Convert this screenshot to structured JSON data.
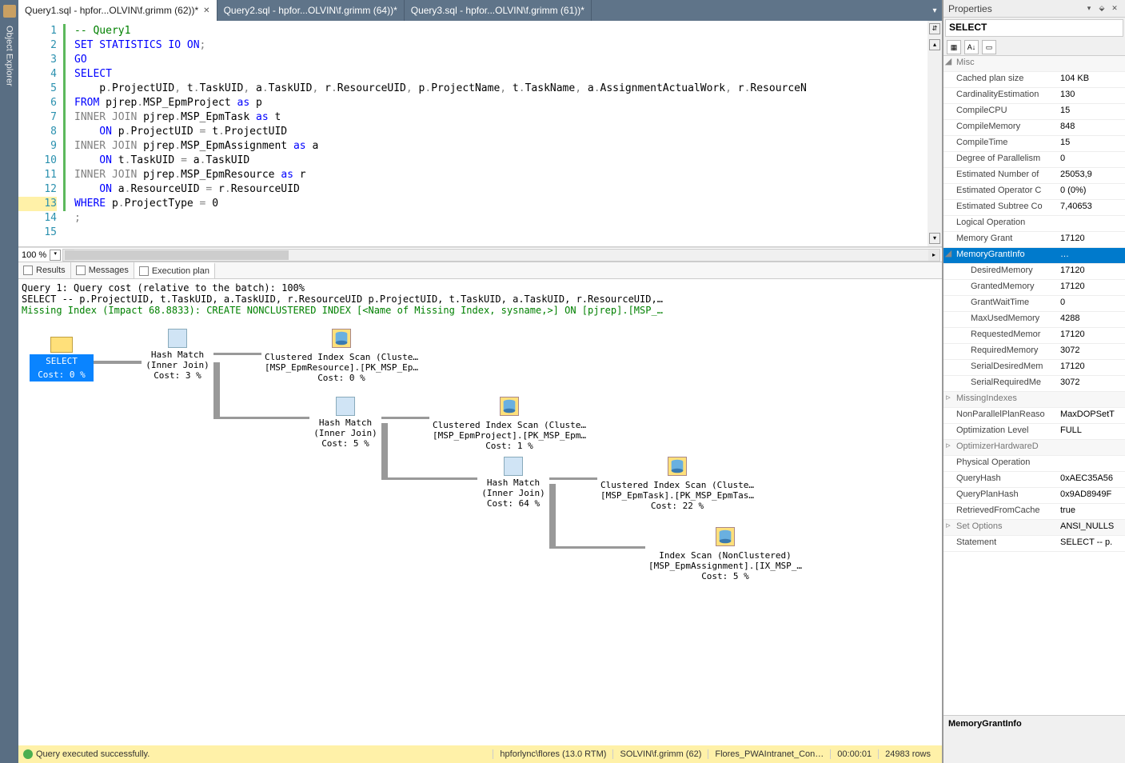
{
  "sidebar": {
    "label": "Object Explorer"
  },
  "tabs": [
    {
      "label": "Query1.sql - hpfor...OLVIN\\f.grimm (62))*",
      "active": true
    },
    {
      "label": "Query2.sql - hpfor...OLVIN\\f.grimm (64))*",
      "active": false
    },
    {
      "label": "Query3.sql - hpfor...OLVIN\\f.grimm (61))*",
      "active": false
    }
  ],
  "code": {
    "lines": [
      {
        "n": 1,
        "segments": [
          {
            "t": "-- Query1",
            "c": "c-comment"
          }
        ]
      },
      {
        "n": 2,
        "segments": [
          {
            "t": "SET",
            "c": "c-kw"
          },
          {
            "t": " STATISTICS IO ON",
            "c": "c-kw"
          },
          {
            "t": ";",
            "c": "c-gray"
          }
        ]
      },
      {
        "n": 3,
        "segments": [
          {
            "t": "GO",
            "c": "c-kw"
          }
        ]
      },
      {
        "n": 4,
        "segments": [
          {
            "t": "SELECT",
            "c": "c-kw"
          }
        ]
      },
      {
        "n": 5,
        "segments": [
          {
            "t": "    p",
            "c": "c-text"
          },
          {
            "t": ".",
            "c": "c-gray"
          },
          {
            "t": "ProjectUID",
            "c": "c-text"
          },
          {
            "t": ",",
            "c": "c-gray"
          },
          {
            "t": " t",
            "c": "c-text"
          },
          {
            "t": ".",
            "c": "c-gray"
          },
          {
            "t": "TaskUID",
            "c": "c-text"
          },
          {
            "t": ",",
            "c": "c-gray"
          },
          {
            "t": " a",
            "c": "c-text"
          },
          {
            "t": ".",
            "c": "c-gray"
          },
          {
            "t": "TaskUID",
            "c": "c-text"
          },
          {
            "t": ",",
            "c": "c-gray"
          },
          {
            "t": " r",
            "c": "c-text"
          },
          {
            "t": ".",
            "c": "c-gray"
          },
          {
            "t": "ResourceUID",
            "c": "c-text"
          },
          {
            "t": ",",
            "c": "c-gray"
          },
          {
            "t": " p",
            "c": "c-text"
          },
          {
            "t": ".",
            "c": "c-gray"
          },
          {
            "t": "ProjectName",
            "c": "c-text"
          },
          {
            "t": ",",
            "c": "c-gray"
          },
          {
            "t": " t",
            "c": "c-text"
          },
          {
            "t": ".",
            "c": "c-gray"
          },
          {
            "t": "TaskName",
            "c": "c-text"
          },
          {
            "t": ",",
            "c": "c-gray"
          },
          {
            "t": " a",
            "c": "c-text"
          },
          {
            "t": ".",
            "c": "c-gray"
          },
          {
            "t": "AssignmentActualWork",
            "c": "c-text"
          },
          {
            "t": ",",
            "c": "c-gray"
          },
          {
            "t": " r",
            "c": "c-text"
          },
          {
            "t": ".",
            "c": "c-gray"
          },
          {
            "t": "ResourceN",
            "c": "c-text"
          }
        ]
      },
      {
        "n": 6,
        "segments": [
          {
            "t": "FROM",
            "c": "c-kw"
          },
          {
            "t": " pjrep",
            "c": "c-text"
          },
          {
            "t": ".",
            "c": "c-gray"
          },
          {
            "t": "MSP_EpmProject ",
            "c": "c-text"
          },
          {
            "t": "as",
            "c": "c-kw"
          },
          {
            "t": " p",
            "c": "c-text"
          }
        ]
      },
      {
        "n": 7,
        "segments": [
          {
            "t": "INNER",
            "c": "c-gray"
          },
          {
            "t": " ",
            "c": "c-text"
          },
          {
            "t": "JOIN",
            "c": "c-gray"
          },
          {
            "t": " pjrep",
            "c": "c-text"
          },
          {
            "t": ".",
            "c": "c-gray"
          },
          {
            "t": "MSP_EpmTask ",
            "c": "c-text"
          },
          {
            "t": "as",
            "c": "c-kw"
          },
          {
            "t": " t",
            "c": "c-text"
          }
        ]
      },
      {
        "n": 8,
        "segments": [
          {
            "t": "    ON",
            "c": "c-kw"
          },
          {
            "t": " p",
            "c": "c-text"
          },
          {
            "t": ".",
            "c": "c-gray"
          },
          {
            "t": "ProjectUID ",
            "c": "c-text"
          },
          {
            "t": "=",
            "c": "c-gray"
          },
          {
            "t": " t",
            "c": "c-text"
          },
          {
            "t": ".",
            "c": "c-gray"
          },
          {
            "t": "ProjectUID",
            "c": "c-text"
          }
        ]
      },
      {
        "n": 9,
        "segments": [
          {
            "t": "INNER",
            "c": "c-gray"
          },
          {
            "t": " ",
            "c": "c-text"
          },
          {
            "t": "JOIN",
            "c": "c-gray"
          },
          {
            "t": " pjrep",
            "c": "c-text"
          },
          {
            "t": ".",
            "c": "c-gray"
          },
          {
            "t": "MSP_EpmAssignment ",
            "c": "c-text"
          },
          {
            "t": "as",
            "c": "c-kw"
          },
          {
            "t": " a",
            "c": "c-text"
          }
        ]
      },
      {
        "n": 10,
        "segments": [
          {
            "t": "    ON",
            "c": "c-kw"
          },
          {
            "t": " t",
            "c": "c-text"
          },
          {
            "t": ".",
            "c": "c-gray"
          },
          {
            "t": "TaskUID ",
            "c": "c-text"
          },
          {
            "t": "=",
            "c": "c-gray"
          },
          {
            "t": " a",
            "c": "c-text"
          },
          {
            "t": ".",
            "c": "c-gray"
          },
          {
            "t": "TaskUID",
            "c": "c-text"
          }
        ]
      },
      {
        "n": 11,
        "segments": [
          {
            "t": "INNER",
            "c": "c-gray"
          },
          {
            "t": " ",
            "c": "c-text"
          },
          {
            "t": "JOIN",
            "c": "c-gray"
          },
          {
            "t": " pjrep",
            "c": "c-text"
          },
          {
            "t": ".",
            "c": "c-gray"
          },
          {
            "t": "MSP_EpmResource ",
            "c": "c-text"
          },
          {
            "t": "as",
            "c": "c-kw"
          },
          {
            "t": " r",
            "c": "c-text"
          }
        ]
      },
      {
        "n": 12,
        "segments": [
          {
            "t": "    ON",
            "c": "c-kw"
          },
          {
            "t": " a",
            "c": "c-text"
          },
          {
            "t": ".",
            "c": "c-gray"
          },
          {
            "t": "ResourceUID ",
            "c": "c-text"
          },
          {
            "t": "=",
            "c": "c-gray"
          },
          {
            "t": " r",
            "c": "c-text"
          },
          {
            "t": ".",
            "c": "c-gray"
          },
          {
            "t": "ResourceUID",
            "c": "c-text"
          }
        ]
      },
      {
        "n": 13,
        "hl": true,
        "segments": [
          {
            "t": "WHERE",
            "c": "c-kw"
          },
          {
            "t": " p",
            "c": "c-text"
          },
          {
            "t": ".",
            "c": "c-gray"
          },
          {
            "t": "ProjectType ",
            "c": "c-text"
          },
          {
            "t": "=",
            "c": "c-gray"
          },
          {
            "t": " 0",
            "c": "c-text"
          }
        ]
      },
      {
        "n": 14,
        "segments": [
          {
            "t": ";",
            "c": "c-gray"
          }
        ]
      },
      {
        "n": 15,
        "segments": [
          {
            "t": "",
            "c": "c-text"
          }
        ]
      }
    ]
  },
  "zoom": "100 %",
  "result_tabs": [
    {
      "label": "Results",
      "active": false
    },
    {
      "label": "Messages",
      "active": false
    },
    {
      "label": "Execution plan",
      "active": true
    }
  ],
  "plan": {
    "header1": "Query 1: Query cost (relative to the batch): 100%",
    "header2": "SELECT -- p.ProjectUID, t.TaskUID, a.TaskUID, r.ResourceUID p.ProjectUID, t.TaskUID, a.TaskUID, r.ResourceUID,…",
    "header3": "Missing Index (Impact 68.8833): CREATE NONCLUSTERED INDEX [<Name of Missing Index, sysname,>] ON [pjrep].[MSP_…",
    "select": {
      "label": "SELECT",
      "cost": "Cost: 0 %"
    },
    "nodes": [
      {
        "id": "hm1",
        "title": "Hash Match",
        "sub": "(Inner Join)",
        "cost": "Cost: 3 %"
      },
      {
        "id": "cis1",
        "title": "Clustered Index Scan (Cluste…",
        "sub": "[MSP_EpmResource].[PK_MSP_Ep…",
        "cost": "Cost: 0 %"
      },
      {
        "id": "hm2",
        "title": "Hash Match",
        "sub": "(Inner Join)",
        "cost": "Cost: 5 %"
      },
      {
        "id": "cis2",
        "title": "Clustered Index Scan (Cluste…",
        "sub": "[MSP_EpmProject].[PK_MSP_Epm…",
        "cost": "Cost: 1 %"
      },
      {
        "id": "hm3",
        "title": "Hash Match",
        "sub": "(Inner Join)",
        "cost": "Cost: 64 %"
      },
      {
        "id": "cis3",
        "title": "Clustered Index Scan (Cluste…",
        "sub": "[MSP_EpmTask].[PK_MSP_EpmTas…",
        "cost": "Cost: 22 %"
      },
      {
        "id": "is1",
        "title": "Index Scan (NonClustered)",
        "sub": "[MSP_EpmAssignment].[IX_MSP_…",
        "cost": "Cost: 5 %"
      }
    ]
  },
  "status": {
    "msg": "Query executed successfully.",
    "server": "hpforlync\\flores (13.0 RTM)",
    "user": "SOLVIN\\f.grimm (62)",
    "db": "Flores_PWAIntranet_Con…",
    "time": "00:00:01",
    "rows": "24983 rows"
  },
  "properties": {
    "title": "Properties",
    "object": "SELECT",
    "rows": [
      {
        "type": "cat",
        "exp": "◢",
        "name": "Misc",
        "val": ""
      },
      {
        "type": "p",
        "name": "Cached plan size",
        "val": "104 KB"
      },
      {
        "type": "p",
        "name": "CardinalityEstimation",
        "val": "130"
      },
      {
        "type": "p",
        "name": "CompileCPU",
        "val": "15"
      },
      {
        "type": "p",
        "name": "CompileMemory",
        "val": "848"
      },
      {
        "type": "p",
        "name": "CompileTime",
        "val": "15"
      },
      {
        "type": "p",
        "name": "Degree of Parallelism",
        "val": "0"
      },
      {
        "type": "p",
        "name": "Estimated Number of",
        "val": "25053,9"
      },
      {
        "type": "p",
        "name": "Estimated Operator C",
        "val": "0 (0%)"
      },
      {
        "type": "p",
        "name": "Estimated Subtree Co",
        "val": "7,40653"
      },
      {
        "type": "p",
        "name": "Logical Operation",
        "val": ""
      },
      {
        "type": "p",
        "name": "Memory Grant",
        "val": "17120"
      },
      {
        "type": "sel",
        "exp": "◢",
        "name": "MemoryGrantInfo",
        "val": "…"
      },
      {
        "type": "sub",
        "name": "DesiredMemory",
        "val": "17120"
      },
      {
        "type": "sub",
        "name": "GrantedMemory",
        "val": "17120"
      },
      {
        "type": "sub",
        "name": "GrantWaitTime",
        "val": "0"
      },
      {
        "type": "sub",
        "name": "MaxUsedMemory",
        "val": "4288"
      },
      {
        "type": "sub",
        "name": "RequestedMemor",
        "val": "17120"
      },
      {
        "type": "sub",
        "name": "RequiredMemory",
        "val": "3072"
      },
      {
        "type": "sub",
        "name": "SerialDesiredMem",
        "val": "17120"
      },
      {
        "type": "sub",
        "name": "SerialRequiredMe",
        "val": "3072"
      },
      {
        "type": "exp",
        "exp": "▹",
        "name": "MissingIndexes",
        "val": ""
      },
      {
        "type": "p",
        "name": "NonParallelPlanReaso",
        "val": "MaxDOPSetT"
      },
      {
        "type": "p",
        "name": "Optimization Level",
        "val": "FULL"
      },
      {
        "type": "exp",
        "exp": "▹",
        "name": "OptimizerHardwareD",
        "val": ""
      },
      {
        "type": "p",
        "name": "Physical Operation",
        "val": ""
      },
      {
        "type": "p",
        "name": "QueryHash",
        "val": "0xAEC35A56"
      },
      {
        "type": "p",
        "name": "QueryPlanHash",
        "val": "0x9AD8949F"
      },
      {
        "type": "p",
        "name": "RetrievedFromCache",
        "val": "true"
      },
      {
        "type": "exp",
        "exp": "▹",
        "name": "Set Options",
        "val": "ANSI_NULLS"
      },
      {
        "type": "p",
        "name": "Statement",
        "val": "SELECT -- p."
      }
    ],
    "desc_title": "MemoryGrantInfo"
  }
}
